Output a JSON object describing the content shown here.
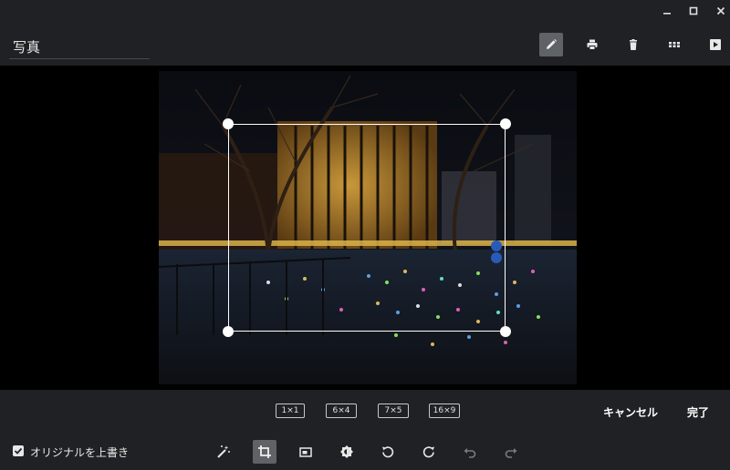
{
  "window": {
    "minimize_glyph": "—",
    "maximize_glyph": "□",
    "close_glyph": "✕"
  },
  "header": {
    "title": "写真",
    "icons": [
      "edit-pencil-icon",
      "print-icon",
      "delete-trash-icon",
      "grid-view-icon",
      "slideshow-play-icon"
    ],
    "active_icon": "edit-pencil-icon"
  },
  "crop": {
    "aspect_ratios": [
      "1×1",
      "6×4",
      "7×5",
      "16×9"
    ],
    "cancel_label": "キャンセル",
    "done_label": "完了"
  },
  "toolbar": {
    "overwrite_checked": true,
    "overwrite_label": "オリジナルを上書き",
    "tools": [
      "auto-fix-wand-icon",
      "crop-icon",
      "aspect-ratio-icon",
      "brightness-icon",
      "rotate-left-icon",
      "rotate-right-icon",
      "undo-icon",
      "redo-icon"
    ],
    "active_tool": "crop-icon",
    "disabled_tools": [
      "undo-icon",
      "redo-icon"
    ]
  },
  "colors": {
    "chrome_bg": "#202124",
    "active_bg": "#5f6368",
    "icon": "#e8e8e8",
    "stage_bg": "#000000"
  }
}
